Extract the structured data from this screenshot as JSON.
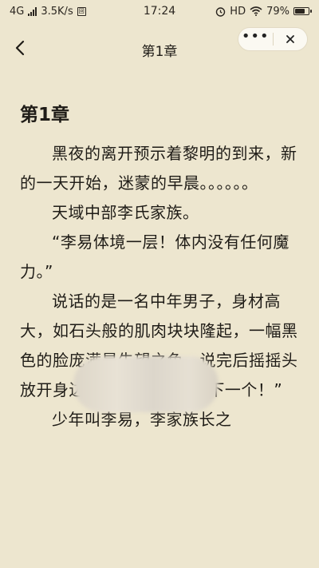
{
  "status_bar": {
    "network": "4G",
    "speed": "3.5K/s",
    "data_saver": "回",
    "time": "17:24",
    "hd": "HD",
    "battery_percent": "79%",
    "battery_level": 0.79
  },
  "header": {
    "title": "第1章",
    "back_icon": "chevron-left-icon",
    "more_icon": "more-icon",
    "close_icon": "close-icon"
  },
  "article": {
    "chapter_title": "第1章",
    "paragraphs": [
      "黑夜的离开预示着黎明的到来，新的一天开始，迷蒙的早晨。。。。。。",
      "天域中部李氏家族。",
      "“李易体境一层！体内没有任何魔力。”",
      "说话的是一名中年男子，身材高大，如石头般的肌肉块块隆起，一幅黑色的脸庞满是失望之色，说完后摇摇头放开身边少年的手臂道：“下一个！”",
      "少年叫李易，李家族长之"
    ]
  },
  "colors": {
    "background": "#ede6cf",
    "text": "#1f1c17",
    "capsule": "#fbf9f2"
  }
}
